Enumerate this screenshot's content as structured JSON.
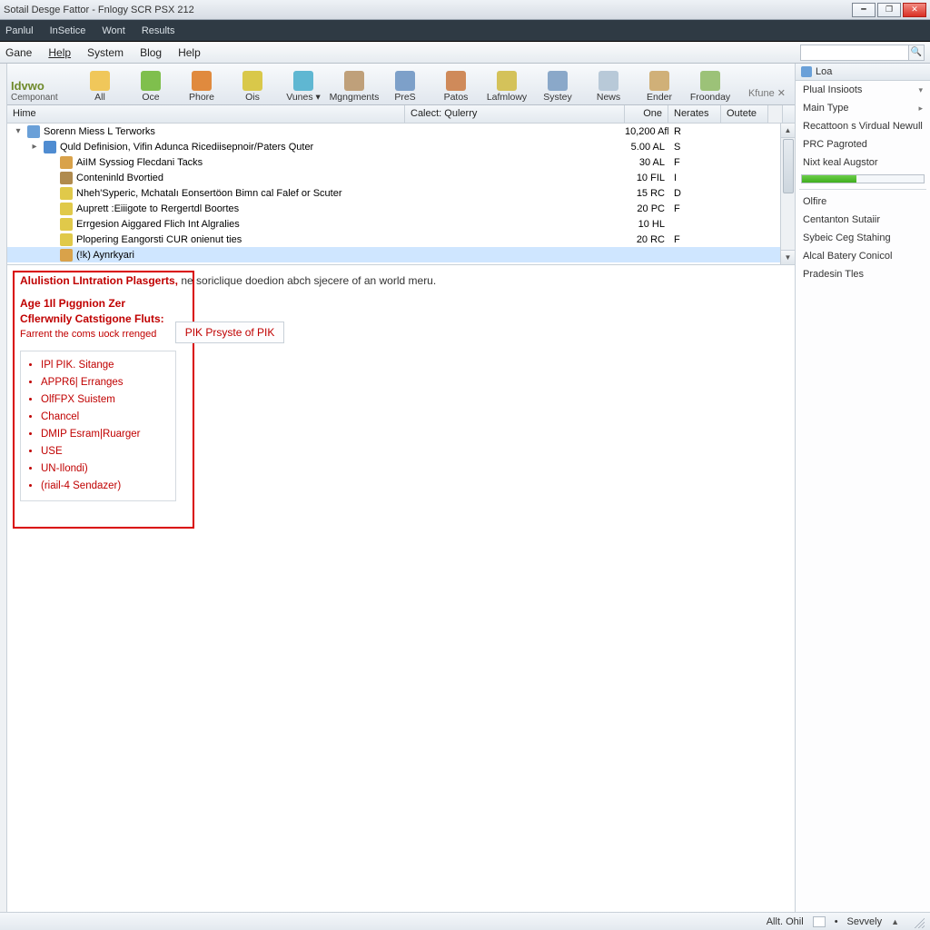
{
  "window": {
    "title": "Sotail Desge Fattor - Fnlogy SCR PSX 212"
  },
  "darkmenu": {
    "items": [
      "Panlul",
      "InSetice",
      "Wont",
      "Results"
    ]
  },
  "menubar": {
    "items": [
      "Gane",
      "Help",
      "System",
      "Blog",
      "Help"
    ],
    "search_placeholder": ""
  },
  "toolbar": {
    "logo_brand": "Idvwo",
    "logo_sub": "Cemponant",
    "items": [
      {
        "label": "All"
      },
      {
        "label": "Oce"
      },
      {
        "label": "Phore"
      },
      {
        "label": "Ois"
      },
      {
        "label": "Vunes ▾"
      },
      {
        "label": "Mgngments"
      },
      {
        "label": "PreS"
      },
      {
        "label": "Patos"
      },
      {
        "label": "Lafmlowy"
      },
      {
        "label": "Systey"
      },
      {
        "label": "News"
      },
      {
        "label": "Ender"
      },
      {
        "label": "Froonday"
      }
    ],
    "close_label": "Kfune ✕"
  },
  "grid": {
    "headers": {
      "name": "Hime",
      "cal": "Calect: Qulerry",
      "one": "One",
      "ner": "Nerates",
      "out": "Outete"
    },
    "rows": [
      {
        "indent": 0,
        "exp": "▾",
        "icon": "#6aa0d8",
        "name": "Sorenn Miess L Terworks",
        "one": "10,200",
        "oneu": "Afl",
        "ner": "R",
        "sel": false
      },
      {
        "indent": 1,
        "exp": "▸",
        "icon": "#4f8cd1",
        "name": "Quld Definision, Vifin Adunca Ricediisepnoir/Paters Quter",
        "one": "5.00",
        "oneu": "AL",
        "ner": "S",
        "sel": false
      },
      {
        "indent": 2,
        "exp": "",
        "icon": "#d9a24a",
        "name": "AiIM Syssiog Flecdani Tacks",
        "one": "30",
        "oneu": "AL",
        "ner": "F",
        "sel": false
      },
      {
        "indent": 2,
        "exp": "",
        "icon": "#b08b4e",
        "name": "Conteninld Bvortied",
        "one": "10",
        "oneu": "FIL",
        "ner": "I",
        "sel": false
      },
      {
        "indent": 2,
        "exp": "",
        "icon": "#e0c94a",
        "name": "Nheh'Syperic, Mchatalı Eonsertöon Bimn cal Falef or Scuter",
        "one": "15",
        "oneu": "RC",
        "ner": "D",
        "sel": false
      },
      {
        "indent": 2,
        "exp": "",
        "icon": "#e0c94a",
        "name": "Auprett :Eiiigote to Rergertdl Boortes",
        "one": "20",
        "oneu": "PC",
        "ner": "F",
        "sel": false
      },
      {
        "indent": 2,
        "exp": "",
        "icon": "#e0c94a",
        "name": "Errgesion Aiggared Flich Int Algralies",
        "one": "10",
        "oneu": "HL",
        "ner": "",
        "sel": false
      },
      {
        "indent": 2,
        "exp": "",
        "icon": "#e0c94a",
        "name": "Plopering Eangorsti CUR onienut ties",
        "one": "20",
        "oneu": "RC",
        "ner": "F",
        "sel": false
      },
      {
        "indent": 2,
        "exp": "",
        "icon": "#d9a24a",
        "name": "(!k) Aynrkyari",
        "one": "",
        "oneu": "",
        "ner": "",
        "sel": true
      }
    ]
  },
  "detail": {
    "headline_bold": "Alulistion LIntration Plasgerts,",
    "headline_rest": " ne soriclique doedion abch sjecere of an world meru.",
    "sub1": "Age 1Il Pıggnion Zer",
    "sub2": "Cflerwnily Catstigone Fluts:",
    "note": "Farrent the coms uock rrenged",
    "button": "PIK Prsyste of PIK",
    "list": [
      "IPl PIK. Sitange",
      "APPR6| Erranges",
      "OlfFPX Suistem",
      "Chancel",
      "DMIP Esram|Ruarger",
      "USE",
      "UN-Ilondi)",
      "(riail-4 Sendazer)"
    ]
  },
  "side": {
    "header": "Loa",
    "items_top": [
      "Plual Insioots"
    ],
    "panel": [
      {
        "t": "Main Type",
        "arrow": true
      },
      {
        "t": "Recattoon s Virdual Newull"
      },
      {
        "t": "PRC Pagroted"
      },
      {
        "t": "Nixt keal Augstor"
      }
    ],
    "panel2": [
      "Olfire",
      "Centanton Sutaiir",
      "Sybeic Ceg Stahing",
      "Alcal Batery Conicol",
      "Pradesin Tles"
    ]
  },
  "status": {
    "left": "",
    "r1": "Allt. Ohil",
    "r2": "Sevvely"
  }
}
